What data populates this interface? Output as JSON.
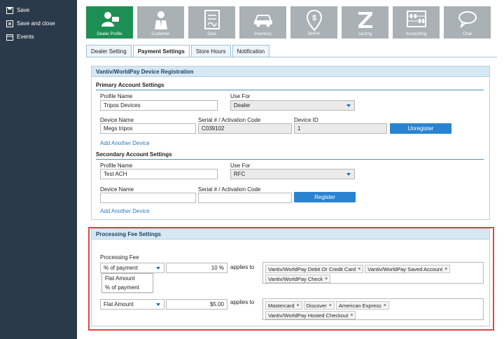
{
  "sidebar": {
    "items": [
      {
        "label": "Save",
        "icon": "save-icon"
      },
      {
        "label": "Save and close",
        "icon": "save-close-icon"
      },
      {
        "label": "Events",
        "icon": "events-icon"
      }
    ]
  },
  "iconbar": {
    "tiles": [
      {
        "label": "Dealer Profile",
        "icon": "dealer-profile-icon",
        "active": true
      },
      {
        "label": "Customer",
        "icon": "customer-icon"
      },
      {
        "label": "Deal",
        "icon": "deal-icon"
      },
      {
        "label": "Inventory",
        "icon": "car-icon"
      },
      {
        "label": "BHPH",
        "icon": "dollar-pin-icon"
      },
      {
        "label": "carzing",
        "icon": "carzing-logo-icon"
      },
      {
        "label": "Accounting",
        "icon": "abacus-icon"
      },
      {
        "label": "Chat",
        "icon": "chat-icon"
      }
    ]
  },
  "tabs": [
    {
      "label": "Dealer Setting"
    },
    {
      "label": "Payment Settings",
      "active": true
    },
    {
      "label": "Store Hours"
    },
    {
      "label": "Notification"
    }
  ],
  "device_panel": {
    "title": "Vantiv/WorldPay Device Registration",
    "primary": {
      "title": "Primary Account Settings",
      "profile_name_label": "Profile Name",
      "profile_name": "Tripos Devices",
      "use_for_label": "Use For",
      "use_for": "Dealer",
      "device_name_label": "Device Name",
      "device_name": "Megs tripos",
      "serial_label": "Serial # / Activation Code",
      "serial": "C039102",
      "device_id_label": "Device ID",
      "device_id": "1",
      "unregister_label": "Unregister",
      "add_device_label": "Add Another Device"
    },
    "secondary": {
      "title": "Secondary Account Settings",
      "profile_name_label": "Profile Name",
      "profile_name": "Test ACH",
      "use_for_label": "Use For",
      "use_for": "RFC",
      "device_name_label": "Device Name",
      "device_name": "",
      "serial_label": "Serial # / Activation Code",
      "serial": "",
      "register_label": "Register",
      "add_device_label": "Add Another Device"
    }
  },
  "fee_panel": {
    "title": "Processing Fee Settings",
    "fee_label": "Processing Fee",
    "rows": [
      {
        "type": "% of payment",
        "amount": "10 %",
        "applies_label": "applies to",
        "tags": [
          "Vantiv/WorldPay Debit Or Credit Card",
          "Vantiv/WorldPay Saved Account",
          "Vantiv/WorldPay Check"
        ]
      },
      {
        "type": "Flat Amount",
        "amount": "$5.00",
        "applies_label": "applies to",
        "tags": [
          "Mastercard",
          "Discover",
          "American Express",
          "Vantiv/WorldPay Hosted Checkout"
        ]
      }
    ],
    "dropdown_options": [
      "Flat Amount",
      "% of payment"
    ]
  },
  "colors": {
    "sidebar": "#2b3a4a",
    "active_tile": "#1e8f54",
    "tile": "#a9b1b5",
    "button": "#2a83d0",
    "highlight": "#e04646"
  }
}
